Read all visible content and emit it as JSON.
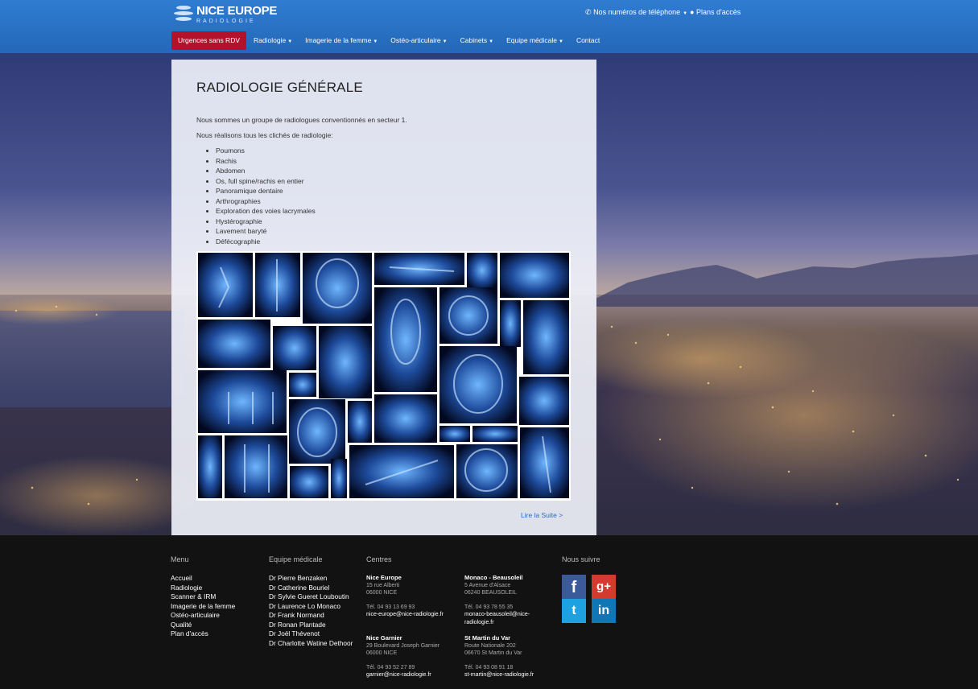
{
  "header": {
    "logo_title": "NICE EUROPE",
    "logo_subtitle": "RADIOLOGIE",
    "phones_link": "Nos numéros de téléphone",
    "maps_link": "Plans d'accès"
  },
  "nav": {
    "items": [
      {
        "label": "Urgences sans RDV",
        "dropdown": false
      },
      {
        "label": "Radiologie",
        "dropdown": true
      },
      {
        "label": "Imagerie de la femme",
        "dropdown": true
      },
      {
        "label": "Ostéo-articulaire",
        "dropdown": true
      },
      {
        "label": "Cabinets",
        "dropdown": true
      },
      {
        "label": "Equipe médicale",
        "dropdown": true
      },
      {
        "label": "Contact",
        "dropdown": false
      }
    ]
  },
  "main": {
    "title": "RADIOLOGIE GÉNÉRALE",
    "intro": "Nous sommes un groupe de radiologues conventionnés en secteur 1.",
    "intro2": "Nous réalisons tous les clichés de radiologie:",
    "list": [
      "Poumons",
      "Rachis",
      "Abdomen",
      "Os, full spine/rachis en entier",
      "Panoramique dentaire",
      "Arthrographies",
      "Exploration des voies lacrymales",
      "Hystérographie",
      "Lavement baryté",
      "Défécographie"
    ],
    "read_more": "Lire la Suite >"
  },
  "footer": {
    "menu_title": "Menu",
    "menu": [
      "Accueil",
      "Radiologie",
      "Scanner & IRM",
      "Imagerie de la femme",
      "Ostéo-articulaire",
      "Qualité",
      "Plan d'accès"
    ],
    "team_title": "Equipe médicale",
    "team": [
      "Dr Pierre Benzaken",
      "Dr Catherine Bouriel",
      "Dr Sylvie Gueret Louboutin",
      "Dr Laurence Lo Monaco",
      "Dr Frank Normand",
      "Dr Ronan Plantade",
      "Dr Joël Thévenot",
      "Dr Charlotte Watine Dethoor"
    ],
    "centers_title": "Centres",
    "centers": [
      {
        "name": "Nice Europe",
        "addr1": "15 rue Alberti",
        "addr2": "06000 NICE",
        "tel": "Tél. 04 93 13 69 93",
        "email": "nice-europe@nice-radiologie.fr",
        "email2": ""
      },
      {
        "name": "Monaco - Beausoleil",
        "addr1": "5 Avenue d'Alsace",
        "addr2": "06240 BEAUSOLEIL",
        "tel": "Tél. 04 93 78 55 35",
        "email": "monaco-beausoleil@nice-",
        "email2": "radiologie.fr"
      },
      {
        "name": "Nice Garnier",
        "addr1": "29 Boulevard Joseph Garnier",
        "addr2": "06000 NICE",
        "tel": "Tél. 04 93 52 27 89",
        "email": "garnier@nice-radiologie.fr",
        "email2": ""
      },
      {
        "name": "St Martin du Var",
        "addr1": "Route Nationale 202",
        "addr2": "06670 St Martin du Var",
        "tel": "Tél. 04 93 08 91 18",
        "email": "st-martin@nice-radiologie.fr",
        "email2": ""
      }
    ],
    "follow_title": "Nous suivre",
    "social": [
      {
        "name": "facebook",
        "glyph": "f"
      },
      {
        "name": "google-plus",
        "glyph": "g+"
      },
      {
        "name": "twitter",
        "glyph": "t"
      },
      {
        "name": "linkedin",
        "glyph": "in"
      }
    ]
  },
  "colors": {
    "header_blue": "#2a72c4",
    "urgent_red": "#b4122b",
    "link_blue": "#2b6cc0",
    "footer_bg": "#121212"
  }
}
